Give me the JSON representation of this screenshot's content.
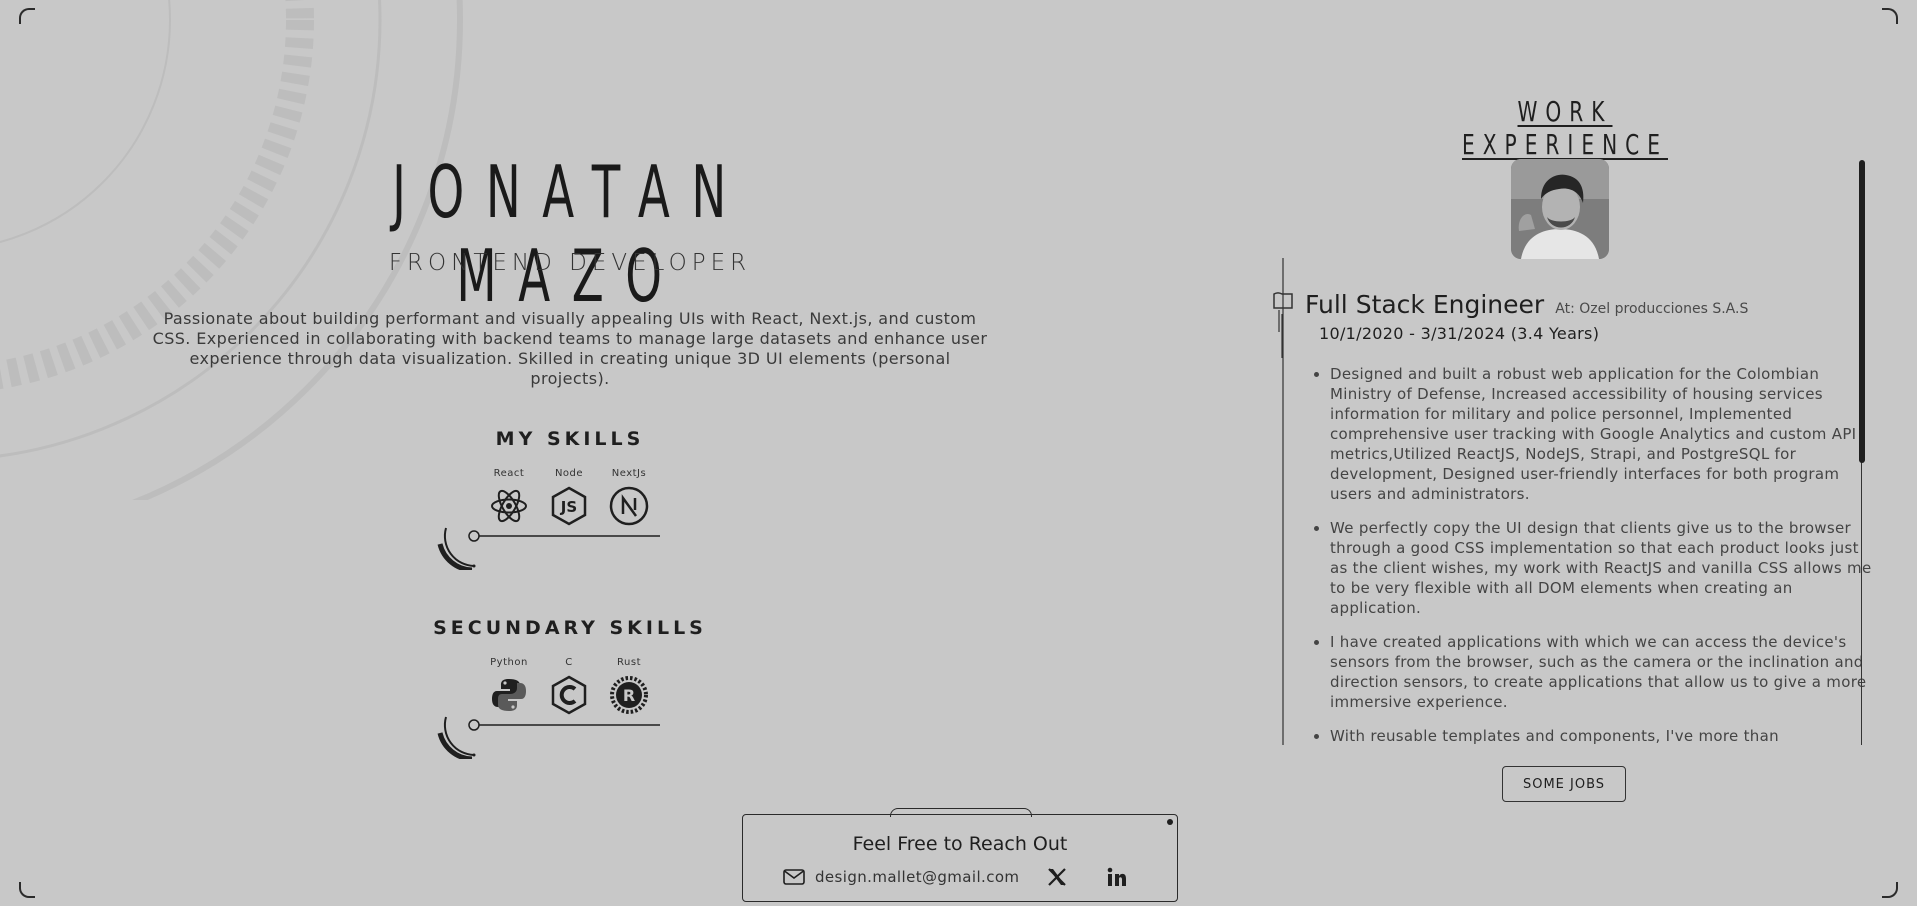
{
  "profile": {
    "name": "JONATAN MAZO",
    "role": "FRONTEND DEVELOPER",
    "bio": "Passionate about building performant and visually appealing UIs with React, Next.js, and custom CSS. Experienced in collaborating with backend teams to manage large datasets and enhance user experience through data visualization. Skilled in creating unique 3D UI elements (personal projects)."
  },
  "skills": {
    "primary_title": "MY SKILLS",
    "primary": [
      {
        "name": "React",
        "icon": "react-icon"
      },
      {
        "name": "Node",
        "icon": "nodejs-icon"
      },
      {
        "name": "NextJs",
        "icon": "nextjs-icon"
      }
    ],
    "secondary_title": "SECUNDARY SKILLS",
    "secondary": [
      {
        "name": "Python",
        "icon": "python-icon"
      },
      {
        "name": "C",
        "icon": "c-language-icon"
      },
      {
        "name": "Rust",
        "icon": "rust-icon"
      }
    ]
  },
  "experience": {
    "title": "WORK EXPERIENCE",
    "job": {
      "title": "Full Stack Engineer",
      "company": "At: Ozel producciones S.A.S",
      "dates": "10/1/2020 - 3/31/2024 (3.4 Years)",
      "bullets": [
        "Designed and built a robust web application for the Colombian Ministry of Defense, Increased accessibility of housing services information for military and police personnel, Implemented comprehensive user tracking with Google Analytics and custom API metrics,Utilized ReactJS, NodeJS, Strapi, and PostgreSQL for development, Designed user-friendly interfaces for both program users and administrators.",
        "We perfectly copy the UI design that clients give us to the browser through a good CSS implementation so that each product looks just as the client wishes, my work with ReactJS and vanilla CSS allows me to be very flexible with all DOM elements when creating an application.",
        "I have created applications with which we can access the device's sensors from the browser, such as the camera or the inclination and direction sensors, to create applications that allow us to give a more immersive experience.",
        "With reusable templates and components, I've more than"
      ]
    },
    "jobs_button": "SOME JOBS"
  },
  "contact": {
    "title": "Feel Free to Reach Out",
    "email": "design.mallet@gmail.com",
    "icons": [
      "mail-icon",
      "x-twitter-icon",
      "linkedin-icon"
    ]
  },
  "colors": {
    "background": "#c8c8c8",
    "ink": "#1f1f1f"
  }
}
